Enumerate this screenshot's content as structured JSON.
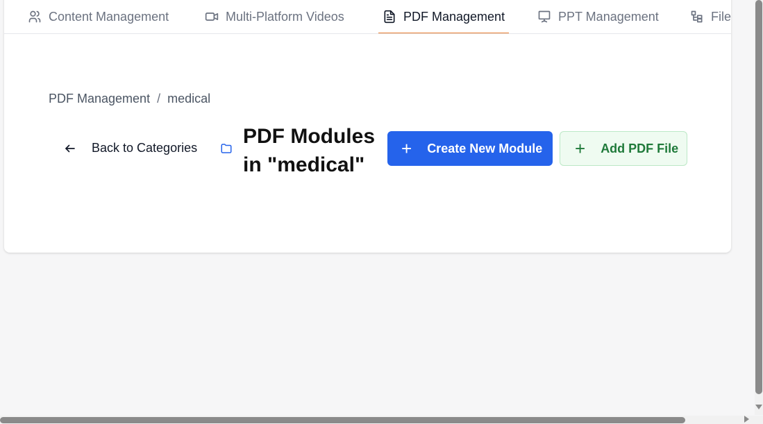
{
  "tabs": [
    {
      "label": "Content Management",
      "icon": "users-icon",
      "active": false
    },
    {
      "label": "Multi-Platform Videos",
      "icon": "video-icon",
      "active": false
    },
    {
      "label": "PDF Management",
      "icon": "document-icon",
      "active": true
    },
    {
      "label": "PPT Management",
      "icon": "presentation-icon",
      "active": false
    },
    {
      "label": "File Ma",
      "icon": "file-tree-icon",
      "active": false
    }
  ],
  "breadcrumb": {
    "parent": "PDF Management",
    "separator": "/",
    "current": "medical"
  },
  "header": {
    "back_label": "Back to Categories",
    "title": "PDF Modules in \"medical\"",
    "create_button": "Create New Module",
    "add_button": "Add PDF File"
  },
  "colors": {
    "accent_tab": "#e8792a",
    "primary": "#2563eb",
    "secondary_bg": "#effbf1",
    "secondary_text": "#1f7a3a"
  }
}
